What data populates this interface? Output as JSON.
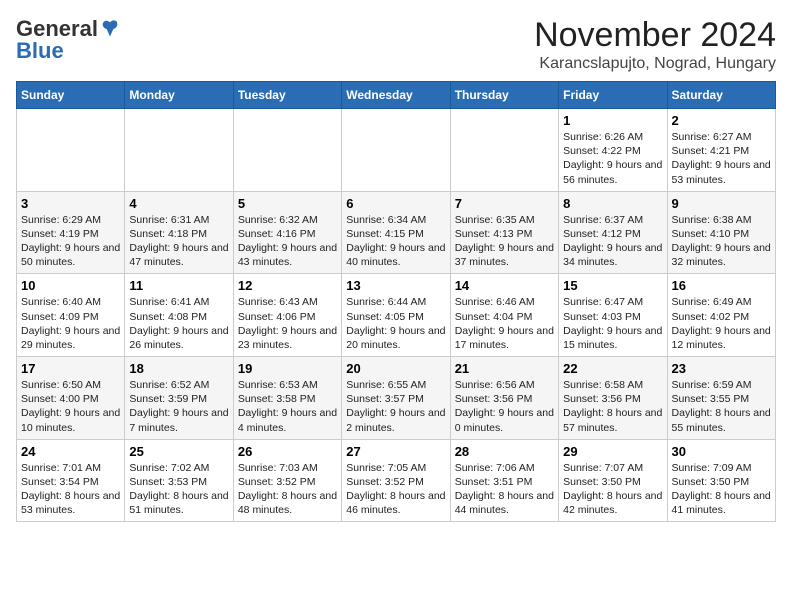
{
  "logo": {
    "general": "General",
    "blue": "Blue"
  },
  "title": "November 2024",
  "subtitle": "Karancslapujto, Nograd, Hungary",
  "days_of_week": [
    "Sunday",
    "Monday",
    "Tuesday",
    "Wednesday",
    "Thursday",
    "Friday",
    "Saturday"
  ],
  "weeks": [
    [
      {
        "day": "",
        "info": ""
      },
      {
        "day": "",
        "info": ""
      },
      {
        "day": "",
        "info": ""
      },
      {
        "day": "",
        "info": ""
      },
      {
        "day": "",
        "info": ""
      },
      {
        "day": "1",
        "info": "Sunrise: 6:26 AM\nSunset: 4:22 PM\nDaylight: 9 hours and 56 minutes."
      },
      {
        "day": "2",
        "info": "Sunrise: 6:27 AM\nSunset: 4:21 PM\nDaylight: 9 hours and 53 minutes."
      }
    ],
    [
      {
        "day": "3",
        "info": "Sunrise: 6:29 AM\nSunset: 4:19 PM\nDaylight: 9 hours and 50 minutes."
      },
      {
        "day": "4",
        "info": "Sunrise: 6:31 AM\nSunset: 4:18 PM\nDaylight: 9 hours and 47 minutes."
      },
      {
        "day": "5",
        "info": "Sunrise: 6:32 AM\nSunset: 4:16 PM\nDaylight: 9 hours and 43 minutes."
      },
      {
        "day": "6",
        "info": "Sunrise: 6:34 AM\nSunset: 4:15 PM\nDaylight: 9 hours and 40 minutes."
      },
      {
        "day": "7",
        "info": "Sunrise: 6:35 AM\nSunset: 4:13 PM\nDaylight: 9 hours and 37 minutes."
      },
      {
        "day": "8",
        "info": "Sunrise: 6:37 AM\nSunset: 4:12 PM\nDaylight: 9 hours and 34 minutes."
      },
      {
        "day": "9",
        "info": "Sunrise: 6:38 AM\nSunset: 4:10 PM\nDaylight: 9 hours and 32 minutes."
      }
    ],
    [
      {
        "day": "10",
        "info": "Sunrise: 6:40 AM\nSunset: 4:09 PM\nDaylight: 9 hours and 29 minutes."
      },
      {
        "day": "11",
        "info": "Sunrise: 6:41 AM\nSunset: 4:08 PM\nDaylight: 9 hours and 26 minutes."
      },
      {
        "day": "12",
        "info": "Sunrise: 6:43 AM\nSunset: 4:06 PM\nDaylight: 9 hours and 23 minutes."
      },
      {
        "day": "13",
        "info": "Sunrise: 6:44 AM\nSunset: 4:05 PM\nDaylight: 9 hours and 20 minutes."
      },
      {
        "day": "14",
        "info": "Sunrise: 6:46 AM\nSunset: 4:04 PM\nDaylight: 9 hours and 17 minutes."
      },
      {
        "day": "15",
        "info": "Sunrise: 6:47 AM\nSunset: 4:03 PM\nDaylight: 9 hours and 15 minutes."
      },
      {
        "day": "16",
        "info": "Sunrise: 6:49 AM\nSunset: 4:02 PM\nDaylight: 9 hours and 12 minutes."
      }
    ],
    [
      {
        "day": "17",
        "info": "Sunrise: 6:50 AM\nSunset: 4:00 PM\nDaylight: 9 hours and 10 minutes."
      },
      {
        "day": "18",
        "info": "Sunrise: 6:52 AM\nSunset: 3:59 PM\nDaylight: 9 hours and 7 minutes."
      },
      {
        "day": "19",
        "info": "Sunrise: 6:53 AM\nSunset: 3:58 PM\nDaylight: 9 hours and 4 minutes."
      },
      {
        "day": "20",
        "info": "Sunrise: 6:55 AM\nSunset: 3:57 PM\nDaylight: 9 hours and 2 minutes."
      },
      {
        "day": "21",
        "info": "Sunrise: 6:56 AM\nSunset: 3:56 PM\nDaylight: 9 hours and 0 minutes."
      },
      {
        "day": "22",
        "info": "Sunrise: 6:58 AM\nSunset: 3:56 PM\nDaylight: 8 hours and 57 minutes."
      },
      {
        "day": "23",
        "info": "Sunrise: 6:59 AM\nSunset: 3:55 PM\nDaylight: 8 hours and 55 minutes."
      }
    ],
    [
      {
        "day": "24",
        "info": "Sunrise: 7:01 AM\nSunset: 3:54 PM\nDaylight: 8 hours and 53 minutes."
      },
      {
        "day": "25",
        "info": "Sunrise: 7:02 AM\nSunset: 3:53 PM\nDaylight: 8 hours and 51 minutes."
      },
      {
        "day": "26",
        "info": "Sunrise: 7:03 AM\nSunset: 3:52 PM\nDaylight: 8 hours and 48 minutes."
      },
      {
        "day": "27",
        "info": "Sunrise: 7:05 AM\nSunset: 3:52 PM\nDaylight: 8 hours and 46 minutes."
      },
      {
        "day": "28",
        "info": "Sunrise: 7:06 AM\nSunset: 3:51 PM\nDaylight: 8 hours and 44 minutes."
      },
      {
        "day": "29",
        "info": "Sunrise: 7:07 AM\nSunset: 3:50 PM\nDaylight: 8 hours and 42 minutes."
      },
      {
        "day": "30",
        "info": "Sunrise: 7:09 AM\nSunset: 3:50 PM\nDaylight: 8 hours and 41 minutes."
      }
    ]
  ]
}
